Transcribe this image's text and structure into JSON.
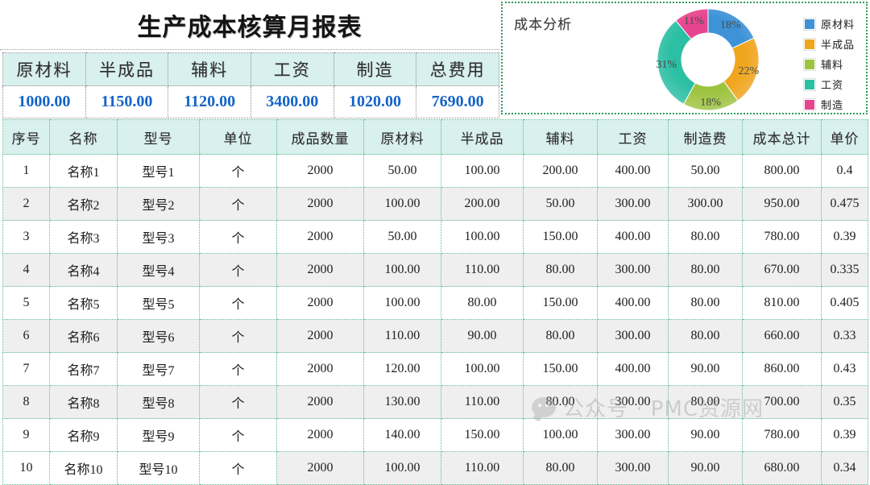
{
  "report": {
    "title": "生产成本核算月报表"
  },
  "summary": {
    "headers": [
      "原材料",
      "半成品",
      "辅料",
      "工资",
      "制造",
      "总费用"
    ],
    "values": [
      "1000.00",
      "1150.00",
      "1120.00",
      "3400.00",
      "1020.00",
      "7690.00"
    ]
  },
  "chart": {
    "title": "成本分析",
    "legend": [
      {
        "label": "原材料",
        "color": "#3e93d8"
      },
      {
        "label": "半成品",
        "color": "#f0a51e"
      },
      {
        "label": "辅料",
        "color": "#9dc33f"
      },
      {
        "label": "工资",
        "color": "#2bbfa3"
      },
      {
        "label": "制造",
        "color": "#e8458f"
      }
    ]
  },
  "chart_data": {
    "type": "pie",
    "title": "成本分析",
    "donut": true,
    "categories": [
      "原材料",
      "半成品",
      "辅料",
      "工资",
      "制造"
    ],
    "values": [
      1000,
      1150,
      1120,
      3400,
      1020
    ],
    "percentages": [
      18,
      22,
      18,
      31,
      11
    ],
    "labels": [
      "18%",
      "22%",
      "18%",
      "31%",
      "11%"
    ],
    "colors": [
      "#3e93d8",
      "#f0a51e",
      "#9dc33f",
      "#2bbfa3",
      "#e8458f"
    ],
    "legend_position": "right",
    "grid": false,
    "xlabel": "",
    "ylabel": ""
  },
  "table": {
    "headers": [
      "序号",
      "名称",
      "型号",
      "单位",
      "成品数量",
      "原材料",
      "半成品",
      "辅料",
      "工资",
      "制造费",
      "成本总计",
      "单价"
    ],
    "rows": [
      [
        "1",
        "名称1",
        "型号1",
        "个",
        "2000",
        "50.00",
        "100.00",
        "200.00",
        "400.00",
        "50.00",
        "800.00",
        "0.4"
      ],
      [
        "2",
        "名称2",
        "型号2",
        "个",
        "2000",
        "100.00",
        "200.00",
        "50.00",
        "300.00",
        "300.00",
        "950.00",
        "0.475"
      ],
      [
        "3",
        "名称3",
        "型号3",
        "个",
        "2000",
        "50.00",
        "100.00",
        "150.00",
        "400.00",
        "80.00",
        "780.00",
        "0.39"
      ],
      [
        "4",
        "名称4",
        "型号4",
        "个",
        "2000",
        "100.00",
        "110.00",
        "80.00",
        "300.00",
        "80.00",
        "670.00",
        "0.335"
      ],
      [
        "5",
        "名称5",
        "型号5",
        "个",
        "2000",
        "100.00",
        "80.00",
        "150.00",
        "400.00",
        "80.00",
        "810.00",
        "0.405"
      ],
      [
        "6",
        "名称6",
        "型号6",
        "个",
        "2000",
        "110.00",
        "90.00",
        "80.00",
        "300.00",
        "80.00",
        "660.00",
        "0.33"
      ],
      [
        "7",
        "名称7",
        "型号7",
        "个",
        "2000",
        "120.00",
        "100.00",
        "150.00",
        "400.00",
        "90.00",
        "860.00",
        "0.43"
      ],
      [
        "8",
        "名称8",
        "型号8",
        "个",
        "2000",
        "130.00",
        "110.00",
        "80.00",
        "300.00",
        "80.00",
        "700.00",
        "0.35"
      ],
      [
        "9",
        "名称9",
        "型号9",
        "个",
        "2000",
        "140.00",
        "150.00",
        "100.00",
        "300.00",
        "90.00",
        "780.00",
        "0.39"
      ],
      [
        "10",
        "名称10",
        "型号10",
        "个",
        "2000",
        "100.00",
        "110.00",
        "80.00",
        "300.00",
        "90.00",
        "680.00",
        "0.34"
      ]
    ]
  },
  "watermark": {
    "text": "公众号 · PMC资源网"
  }
}
